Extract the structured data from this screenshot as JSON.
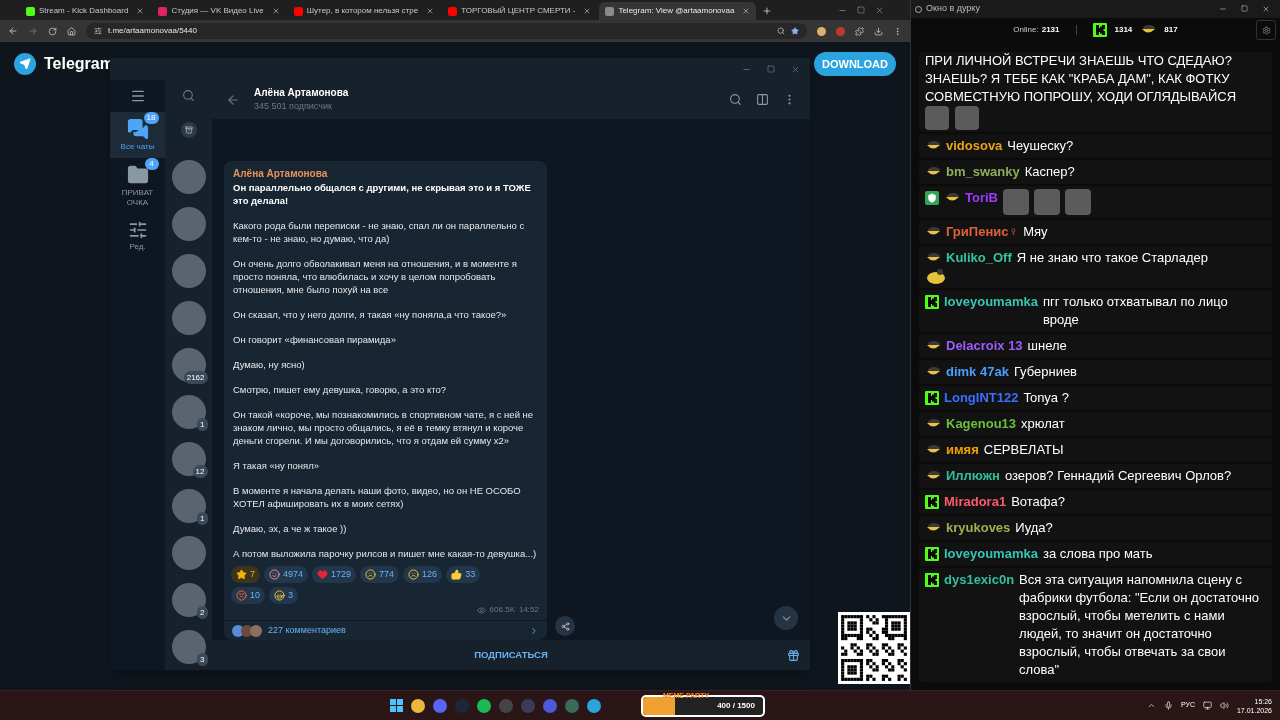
{
  "browser": {
    "tabs": [
      {
        "title": "Stream - Kick Dashboard",
        "kind": "kick",
        "selected": false
      },
      {
        "title": "Студия — VK Видео Live",
        "kind": "vk",
        "selected": false
      },
      {
        "title": "Шутер, в котором нельзя стре",
        "kind": "youtube",
        "selected": false
      },
      {
        "title": "ТОРГОВЫЙ ЦЕНТР СМЕРТИ -",
        "kind": "youtube",
        "selected": false
      },
      {
        "title": "Telegram: View @artaamonovaa",
        "kind": "telegram",
        "selected": true
      }
    ],
    "address": "t.me/artaamonovaa/5440"
  },
  "page": {
    "brand": "Telegram",
    "download": "DOWNLOAD"
  },
  "telegram": {
    "folders": [
      {
        "label": "Все чаты",
        "badge": "18",
        "kind": "chats",
        "selected": true
      },
      {
        "label": "ПРИВАТ ОЧКА",
        "badge": "4",
        "kind": "folder",
        "selected": false
      },
      {
        "label": "Ред.",
        "kind": "edit",
        "selected": false
      }
    ],
    "chats": [
      {
        "kind": "archive"
      },
      {
        "kind": "avatar"
      },
      {
        "kind": "avatar"
      },
      {
        "kind": "avatar"
      },
      {
        "kind": "avatar"
      },
      {
        "kind": "avatar",
        "badge": "2162"
      },
      {
        "kind": "avatar",
        "badge": "1"
      },
      {
        "kind": "avatar",
        "badge": "12"
      },
      {
        "kind": "avatar",
        "badge": "1"
      },
      {
        "kind": "avatar"
      },
      {
        "kind": "avatar",
        "badge": "2"
      },
      {
        "kind": "avatar",
        "badge": "3"
      }
    ],
    "channel": {
      "name": "Алёна Артамонова",
      "subscribers": "345 501 подписчик"
    },
    "post": {
      "author": "Алёна Артамонова",
      "lead": "Он параллельно общался с другими, не скрывая это и я ТОЖЕ это делала!",
      "paragraphs": [
        "Какого рода были переписки - не знаю, спал ли он параллельно с кем-то - не знаю, но думаю, что да)",
        "Он очень долго обволакивал меня на отношения, и в моменте я просто поняла, что влюбилась и хочу в целом попробовать отношения, мне было похуй на все",
        "Он сказал, что у него долги, я такая «ну поняла,а что такое?»",
        "Он говорит «финансовая пирамида»",
        "Думаю, ну ясно)",
        "Смотрю, пишет ему девушка, говорю, а это кто?",
        "Он такой «короче, мы познакомились в спортивном чате, я с ней не знаком лично, мы просто общались, я её в темку втянул и короче деньги сгорели. И мы договорились, что я отдам ей сумму х2»",
        "Я такая «ну понял»",
        "В моменте я начала делать наши фото, видео, но он НЕ ОСОБО ХОТЕЛ афишировать их в моих сетях)",
        "Думаю, эх, а че ж такое ))",
        "А потом выложила парочку рилсов и пишет мне какая-то девушка...)"
      ],
      "reactions": [
        {
          "kind": "star",
          "count": "7"
        },
        {
          "kind": "clown",
          "count": "4974"
        },
        {
          "kind": "heart",
          "count": "1729"
        },
        {
          "kind": "scream",
          "count": "774"
        },
        {
          "kind": "cry",
          "count": "126"
        },
        {
          "kind": "thumbs",
          "count": "33"
        },
        {
          "kind": "hot",
          "count": "10"
        },
        {
          "kind": "love",
          "count": "3"
        }
      ],
      "views": "606.5K",
      "time": "14:52",
      "comments": "227 комментариев"
    },
    "subscribe": "ПОДПИСАТЬСЯ"
  },
  "chat_window": {
    "title": "Окно в дурку",
    "online_label": "Online:",
    "online": "2131",
    "kick_count": "1314",
    "other_count": "817",
    "messages": [
      {
        "kind": "continuation",
        "text": "ПРИ ЛИЧНОЙ ВСТРЕЧИ ЗНАЕШЬ ЧТО СДЕДАЮ? ЗНАЕШЬ? Я ТЕБЕ КАК \"КРАБА ДАМ\", КАК ФОТКУ СОВМЕСТНУЮ ПОПРОШУ, ХОДИ ОГЛЯДЫВАЙСЯ",
        "emotes": [
          {
            "kind": "photo"
          },
          {
            "kind": "photo"
          }
        ]
      },
      {
        "kind": "message",
        "badges": [
          {
            "kind": "bowl"
          }
        ],
        "user": "vidosova",
        "color": "#e8a317",
        "text": "Чеушеску?"
      },
      {
        "kind": "message",
        "badges": [
          {
            "kind": "bowl"
          }
        ],
        "user": "bm_swanky",
        "color": "#8fae5a",
        "text": "Каспер?"
      },
      {
        "kind": "message",
        "badges": [
          {
            "kind": "shield"
          },
          {
            "kind": "bowl"
          }
        ],
        "user": "ToriB",
        "color": "#9b3bff",
        "emotes": [
          {
            "kind": "photo"
          },
          {
            "kind": "photo"
          },
          {
            "kind": "photo"
          }
        ]
      },
      {
        "kind": "message",
        "badges": [
          {
            "kind": "bowl"
          }
        ],
        "user": "ГриПенис♀",
        "color": "#e0603a",
        "text": "Мяу"
      },
      {
        "kind": "message",
        "badges": [
          {
            "kind": "bowl"
          }
        ],
        "user": "Kuliko_Off",
        "color": "#35c3a0",
        "text": "Я не знаю что такое Старладер",
        "emotes": [
          {
            "kind": "sticker"
          }
        ]
      },
      {
        "kind": "message",
        "badges": [
          {
            "kind": "kick"
          }
        ],
        "user": "loveyoumamka",
        "color": "#36c6b4",
        "text": "пгг только отхватывал по лицо вроде"
      },
      {
        "kind": "message",
        "badges": [
          {
            "kind": "bowl"
          }
        ],
        "user": "Delacroix 13",
        "color": "#9d5cff",
        "text": "шнеле"
      },
      {
        "kind": "message",
        "badges": [
          {
            "kind": "bowl"
          }
        ],
        "user": "dimk 47ak",
        "color": "#4a9eff",
        "text": "Губерниев"
      },
      {
        "kind": "message",
        "badges": [
          {
            "kind": "kick"
          }
        ],
        "user": "LongINT122",
        "color": "#3a6fff",
        "text": "Tonya ?"
      },
      {
        "kind": "message",
        "badges": [
          {
            "kind": "bowl"
          }
        ],
        "user": "Kagenou13",
        "color": "#6bbf3a",
        "text": "хрюлат"
      },
      {
        "kind": "message",
        "badges": [
          {
            "kind": "bowl"
          }
        ],
        "user": "имяя",
        "color": "#f0a000",
        "text": "СЕРВЕЛАТЫ"
      },
      {
        "kind": "message",
        "badges": [
          {
            "kind": "bowl"
          }
        ],
        "user": "Иллюжн",
        "color": "#30c0a0",
        "text": "озеров? Геннадий Сергеевич Орлов?"
      },
      {
        "kind": "message",
        "badges": [
          {
            "kind": "kick"
          }
        ],
        "user": "Miradora1",
        "color": "#ff5a6a",
        "text": "Вотафа?"
      },
      {
        "kind": "message",
        "badges": [
          {
            "kind": "bowl"
          }
        ],
        "user": "kryukoves",
        "color": "#a0b050",
        "text": "Иуда?"
      },
      {
        "kind": "message",
        "badges": [
          {
            "kind": "kick"
          }
        ],
        "user": "loveyoumamka",
        "color": "#36c6b4",
        "text": "за слова про мать"
      },
      {
        "kind": "message",
        "badges": [
          {
            "kind": "kick"
          }
        ],
        "user": "dys1exic0n",
        "color": "#30c0a0",
        "text": "Вся эта ситуация напомнила сцену с фабрики футбола: \"Если он достаточно взрослый, чтобы метелить с нами людей, то значит он достаточно взрослый, чтобы отвечать за свои слова\""
      }
    ]
  },
  "taskbar": {
    "widget": {
      "title": "MEME PARTY",
      "progress": "400 / 1500",
      "level": 0.27
    },
    "language": "РУС",
    "time": "15:26",
    "date": "17.01.2026"
  }
}
